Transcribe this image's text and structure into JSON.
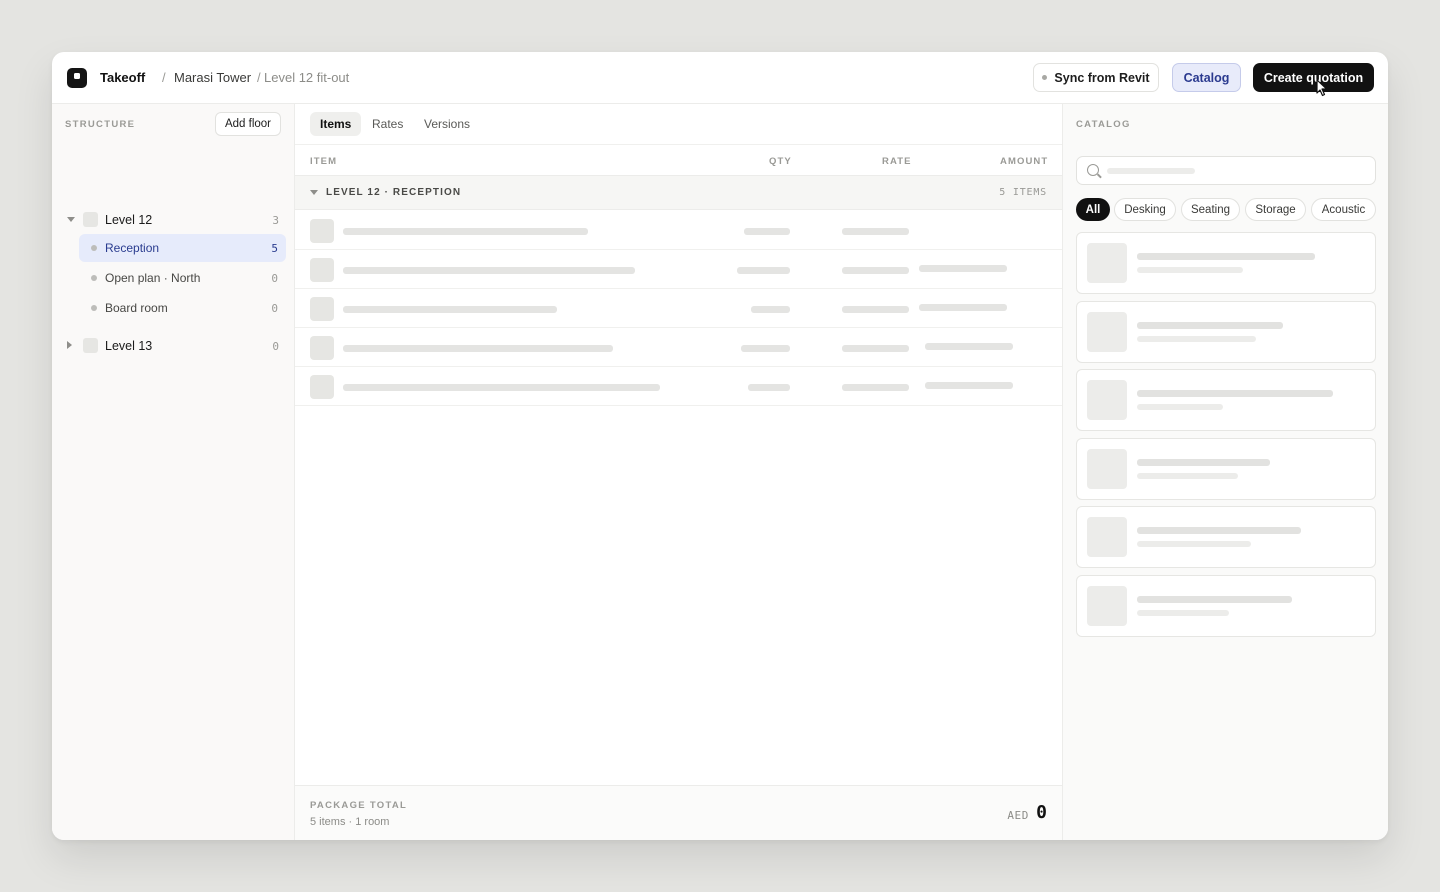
{
  "header": {
    "app_name": "Takeoff",
    "breadcrumb": [
      "Marasi Tower",
      "Level 12 fit-out"
    ],
    "separator": "/",
    "sync_label": "Sync from Revit",
    "catalog_label": "Catalog",
    "create_label": "Create quotation"
  },
  "sidebar": {
    "section_label": "STRUCTURE",
    "add_floor_label": "Add floor",
    "floors": [
      {
        "label": "Level 12",
        "count": "3",
        "expanded": true,
        "rooms": [
          {
            "label": "Reception",
            "count": "5",
            "active": true
          },
          {
            "label": "Open plan · North",
            "count": "0",
            "active": false
          },
          {
            "label": "Board room",
            "count": "0",
            "active": false
          }
        ]
      },
      {
        "label": "Level 13",
        "count": "0",
        "expanded": false,
        "rooms": []
      }
    ]
  },
  "main": {
    "tabs": [
      {
        "label": "Items",
        "active": true
      },
      {
        "label": "Rates",
        "active": false
      },
      {
        "label": "Versions",
        "active": false
      }
    ],
    "columns": {
      "item": "ITEM",
      "qty": "QTY",
      "rate": "RATE",
      "amount": "AMOUNT"
    },
    "group": {
      "title": "LEVEL 12 · RECEPTION",
      "count": "5 ITEMS"
    },
    "footer": {
      "label": "PACKAGE TOTAL",
      "summary": "5 items · 1 room",
      "currency": "AED",
      "total": "0"
    }
  },
  "catalog": {
    "section_label": "CATALOG",
    "search_placeholder": "",
    "chips": [
      {
        "label": "All",
        "active": true
      },
      {
        "label": "Desking",
        "active": false
      },
      {
        "label": "Seating",
        "active": false
      },
      {
        "label": "Storage",
        "active": false
      },
      {
        "label": "Acoustic",
        "active": false
      }
    ]
  },
  "icons": {
    "logo": "app-logo-icon",
    "search": "search-icon",
    "caret_down": "chevron-down-icon",
    "caret_right": "chevron-right-icon",
    "cursor": "mouse-cursor-icon"
  },
  "colors": {
    "accent": "#2b3a8f",
    "accent_bg": "#e8ebfa",
    "primary_button": "#111111"
  }
}
